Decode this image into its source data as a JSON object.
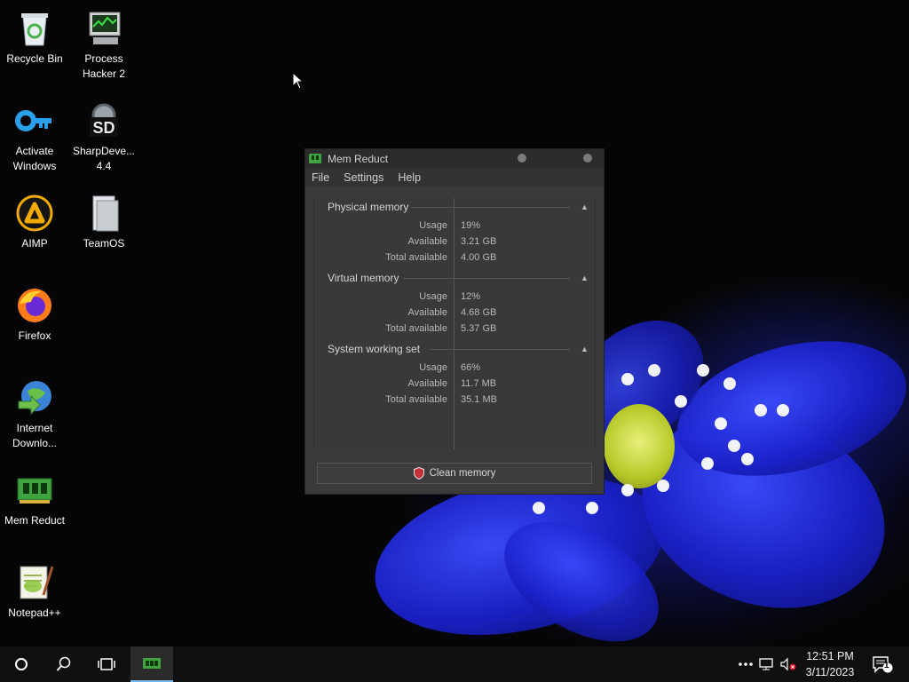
{
  "desktop": {
    "icons": [
      {
        "label": "Recycle Bin",
        "icon": "recycle-bin-icon"
      },
      {
        "label": "Process\nHacker 2",
        "icon": "process-hacker-icon"
      },
      {
        "label": "Activate\nWindows",
        "icon": "key-icon"
      },
      {
        "label": "SharpDeve...\n4.4",
        "icon": "sharpdevelop-icon"
      },
      {
        "label": "AIMP",
        "icon": "aimp-icon"
      },
      {
        "label": "TeamOS",
        "icon": "teamos-icon"
      },
      {
        "label": "Firefox",
        "icon": "firefox-icon"
      },
      {
        "label": "Internet\nDownlo...",
        "icon": "internet-download-manager-icon"
      },
      {
        "label": "Mem Reduct",
        "icon": "mem-reduct-icon"
      },
      {
        "label": "Notepad++",
        "icon": "notepad-plus-plus-icon"
      }
    ]
  },
  "window": {
    "title": "Mem Reduct",
    "menu": [
      "File",
      "Settings",
      "Help"
    ],
    "groups": [
      {
        "title": "Physical memory",
        "rows": [
          {
            "label": "Usage",
            "value": "19%"
          },
          {
            "label": "Available",
            "value": "3.21 GB"
          },
          {
            "label": "Total available",
            "value": "4.00 GB"
          }
        ]
      },
      {
        "title": "Virtual memory",
        "rows": [
          {
            "label": "Usage",
            "value": "12%"
          },
          {
            "label": "Available",
            "value": "4.68 GB"
          },
          {
            "label": "Total available",
            "value": "5.37 GB"
          }
        ]
      },
      {
        "title": "System working set",
        "rows": [
          {
            "label": "Usage",
            "value": "66%"
          },
          {
            "label": "Available",
            "value": "11.7 MB"
          },
          {
            "label": "Total available",
            "value": "35.1 MB"
          }
        ]
      }
    ],
    "clean_button": "Clean memory"
  },
  "taskbar": {
    "time": "12:51 PM",
    "date": "3/11/2023",
    "notification_count": "1"
  },
  "colors": {
    "window_bg": "#3a3a3a",
    "titlebar_bg": "#2b2b2b",
    "taskbar_bg": "#101010",
    "accent": "#76b9ed"
  }
}
